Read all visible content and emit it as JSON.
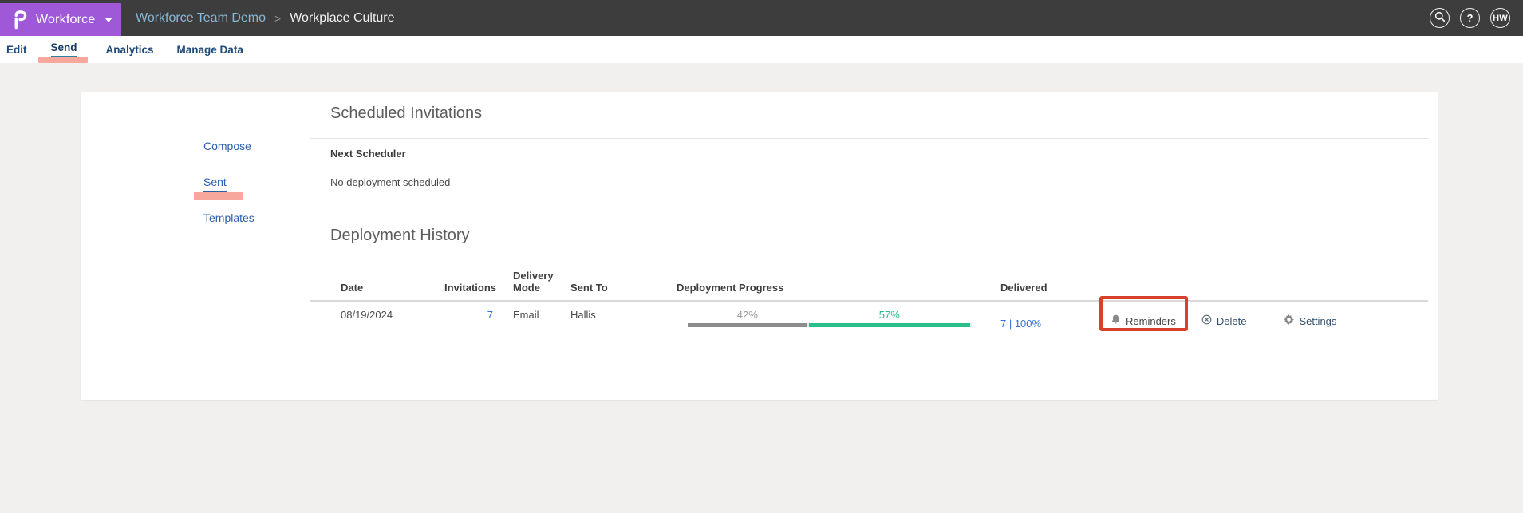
{
  "topbar": {
    "product": "Workforce",
    "breadcrumb": {
      "parent": "Workforce Team Demo",
      "separator": ">",
      "current": "Workplace Culture"
    },
    "avatar_initials": "HW"
  },
  "tabs": [
    {
      "label": "Edit",
      "active": false
    },
    {
      "label": "Send",
      "active": true
    },
    {
      "label": "Analytics",
      "active": false
    },
    {
      "label": "Manage Data",
      "active": false
    }
  ],
  "sidebar": [
    {
      "label": "Compose",
      "active": false
    },
    {
      "label": "Sent",
      "active": true
    },
    {
      "label": "Templates",
      "active": false
    }
  ],
  "sections": {
    "scheduled": {
      "title": "Scheduled Invitations",
      "next_scheduler_label": "Next Scheduler",
      "empty_message": "No deployment scheduled"
    },
    "history": {
      "title": "Deployment History",
      "columns": [
        "Date",
        "Invitations",
        "Delivery Mode",
        "Sent To",
        "Deployment Progress",
        "Delivered"
      ],
      "rows": [
        {
          "date": "08/19/2024",
          "invitations": "7",
          "delivery_mode": "Email",
          "sent_to": "Hallis",
          "progress": {
            "gray_label": "42%",
            "gray_value": 42,
            "green_label": "57%",
            "green_value": 57
          },
          "delivered": "7 | 100%",
          "actions": [
            {
              "icon": "bell-icon",
              "label": "Reminders",
              "highlighted": true
            },
            {
              "icon": "circle-x-icon",
              "label": "Delete",
              "highlighted": false
            },
            {
              "icon": "gear-icon",
              "label": "Settings",
              "highlighted": false
            }
          ]
        }
      ]
    }
  },
  "annotations": {
    "highlight_color": "#f7a79b",
    "box_color": "#d8402c",
    "highlighted_tab": "Send",
    "highlighted_sidebar": "Sent",
    "boxed_action": "Reminders"
  },
  "colors": {
    "brand_purple": "#9e58d8",
    "topbar_bg": "#3d3d3d",
    "breadcrumb_link": "#85b8d8",
    "tab_blue": "#1e4a78",
    "tab_underline": "#2e7fa6",
    "sidebar_link": "#2b5fad",
    "value_link_blue": "#3476d4",
    "progress_gray": "#8c8c8c",
    "progress_green": "#2abf8a"
  }
}
